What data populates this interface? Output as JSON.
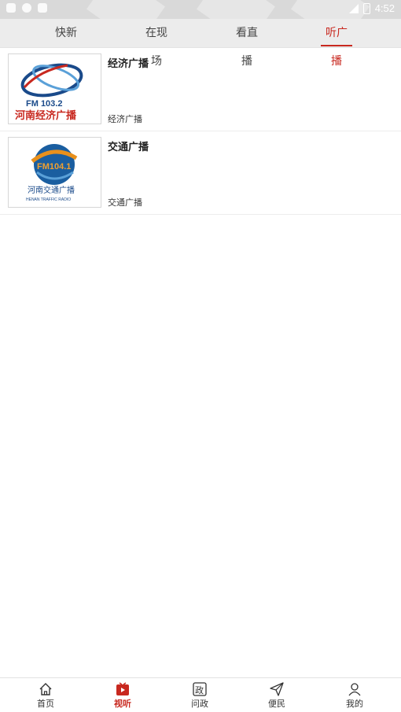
{
  "status_bar": {
    "time": "4:52"
  },
  "tabs": [
    {
      "label": "快新闻",
      "active": false
    },
    {
      "label": "在现场",
      "active": false
    },
    {
      "label": "看直播",
      "active": false
    },
    {
      "label": "听广播",
      "active": true
    }
  ],
  "stations": [
    {
      "title": "经济广播",
      "subtitle": "经济广播",
      "logo_text": "FM 103.2",
      "logo_caption": "河南经济广播"
    },
    {
      "title": "交通广播",
      "subtitle": "交通广播",
      "logo_text": "FM104.1",
      "logo_caption": "河南交通广播",
      "logo_caption_en": "HENAN TRAFFIC RADIO"
    }
  ],
  "bottom_nav": [
    {
      "label": "首页",
      "icon": "home-icon",
      "active": false
    },
    {
      "label": "视听",
      "icon": "play-icon",
      "active": true
    },
    {
      "label": "问政",
      "icon": "zheng-icon",
      "active": false
    },
    {
      "label": "便民",
      "icon": "send-icon",
      "active": false
    },
    {
      "label": "我的",
      "icon": "user-icon",
      "active": false
    }
  ],
  "colors": {
    "accent": "#c8281f",
    "tabbar_bg": "#ececec"
  }
}
